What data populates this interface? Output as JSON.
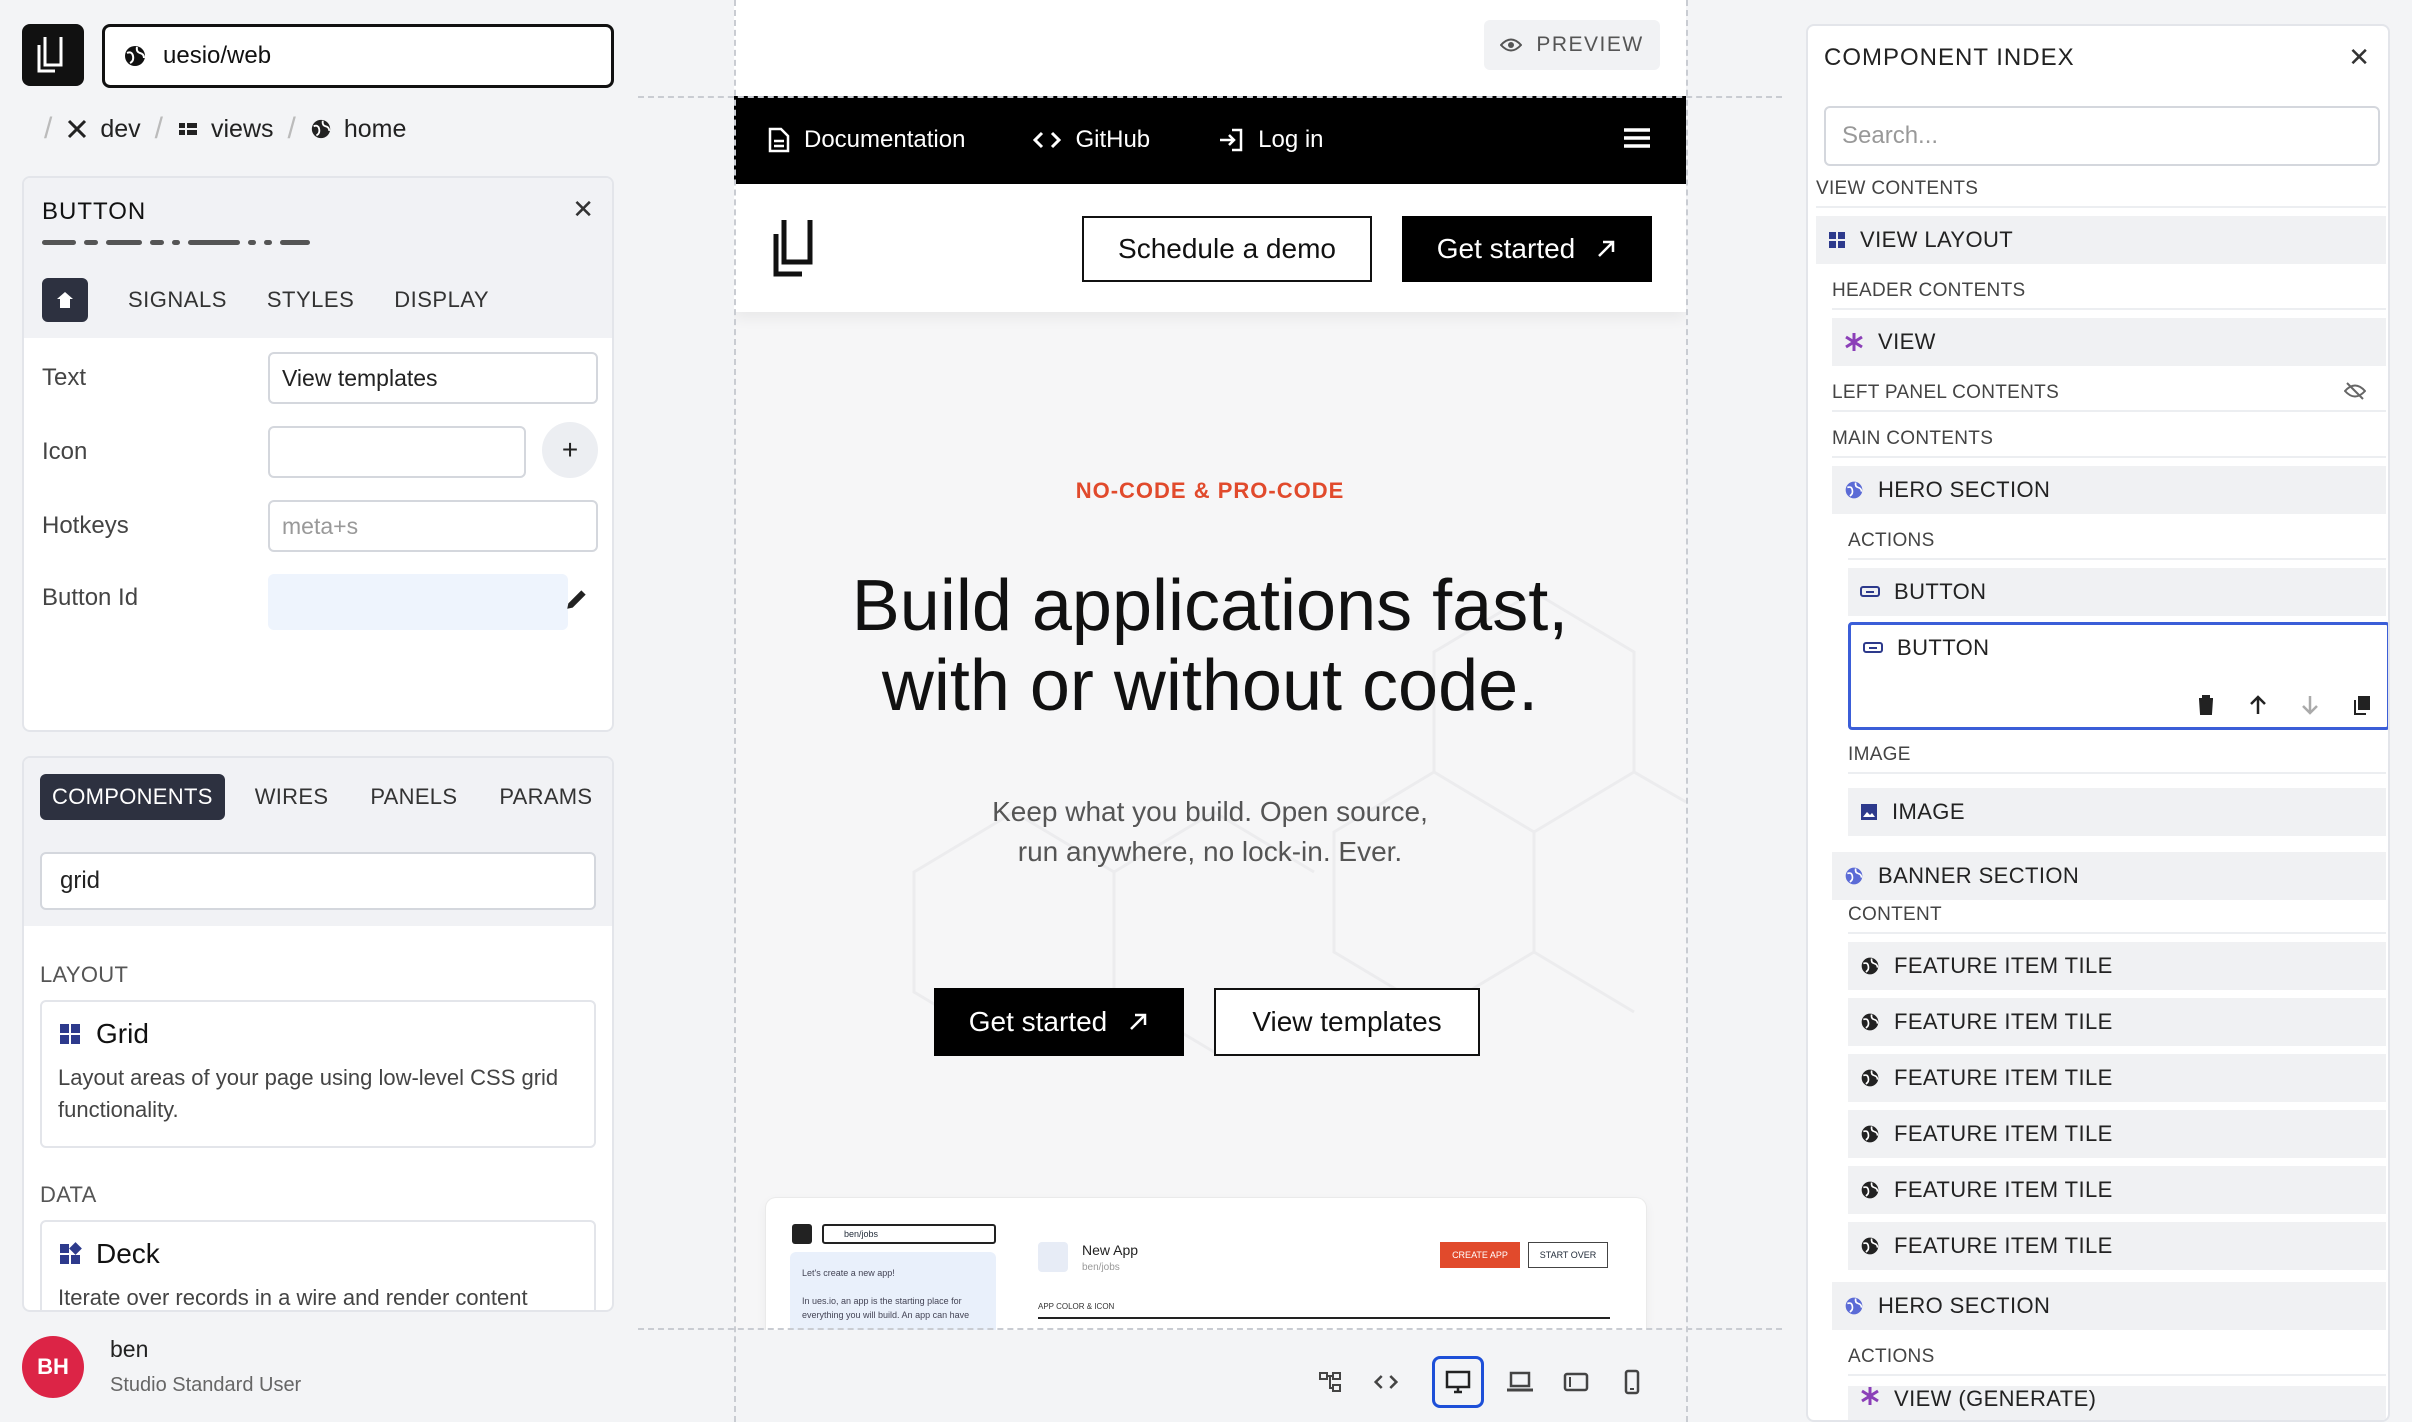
{
  "app": {
    "name": "uesio/web"
  },
  "breadcrumb": {
    "workspace": "dev",
    "section": "views",
    "view": "home"
  },
  "properties": {
    "title": "BUTTON",
    "tabs": [
      "SIGNALS",
      "STYLES",
      "DISPLAY"
    ],
    "fields": {
      "text_label": "Text",
      "text_value": "View templates",
      "icon_label": "Icon",
      "icon_value": "",
      "hotkeys_label": "Hotkeys",
      "hotkeys_placeholder": "meta+s",
      "id_label": "Button Id"
    }
  },
  "components_panel": {
    "tabs": [
      "COMPONENTS",
      "WIRES",
      "PANELS",
      "PARAMS"
    ],
    "search_value": "grid",
    "sections": [
      {
        "label": "LAYOUT",
        "item_title": "Grid",
        "item_desc": "Layout areas of your page using low-level CSS grid functionality."
      },
      {
        "label": "DATA",
        "item_title": "Deck",
        "item_desc": "Iterate over records in a wire and render content"
      }
    ]
  },
  "user": {
    "initials": "BH",
    "name": "ben",
    "role": "Studio Standard User"
  },
  "canvas": {
    "preview_label": "PREVIEW",
    "nav": {
      "docs": "Documentation",
      "github": "GitHub",
      "login": "Log in"
    },
    "header": {
      "demo": "Schedule a demo",
      "start": "Get started"
    },
    "hero": {
      "eyebrow": "NO-CODE & PRO-CODE",
      "title_line1": "Build applications fast,",
      "title_line2": "with or without code.",
      "sub_line1": "Keep what you build. Open source,",
      "sub_line2": "run anywhere, no lock-in. Ever.",
      "primary": "Get started",
      "secondary": "View templates"
    },
    "mock": {
      "url": "ben/jobs",
      "hint1": "Let's create a new app!",
      "hint2": "In ues.io, an app is the starting place for",
      "hint3": "everything you will build. An app can have",
      "app_name": "New App",
      "app_path": "ben/jobs",
      "create": "CREATE APP",
      "startover": "START OVER",
      "field": "APP COLOR & ICON"
    }
  },
  "index": {
    "title": "COMPONENT INDEX",
    "search_placeholder": "Search...",
    "items": {
      "view_contents": "VIEW CONTENTS",
      "view_layout": "VIEW LAYOUT",
      "header_contents": "HEADER CONTENTS",
      "view": "VIEW",
      "left_panel": "LEFT PANEL CONTENTS",
      "main_contents": "MAIN CONTENTS",
      "hero_section": "HERO SECTION",
      "actions": "ACTIONS",
      "button": "BUTTON",
      "button_selected": "BUTTON",
      "image_slot": "IMAGE",
      "image": "IMAGE",
      "banner_section": "BANNER SECTION",
      "content": "CONTENT",
      "feature_tiles": [
        "FEATURE ITEM TILE",
        "FEATURE ITEM TILE",
        "FEATURE ITEM TILE",
        "FEATURE ITEM TILE",
        "FEATURE ITEM TILE",
        "FEATURE ITEM TILE"
      ],
      "hero_section_2": "HERO SECTION",
      "actions_2": "ACTIONS",
      "partial": "VIEW (GENERATE)"
    }
  },
  "colors": {
    "accent": "#1d4fd8",
    "eyebrow": "#e14a2c",
    "avatar": "#dc2446",
    "component_icon": "#5b6bd6"
  }
}
